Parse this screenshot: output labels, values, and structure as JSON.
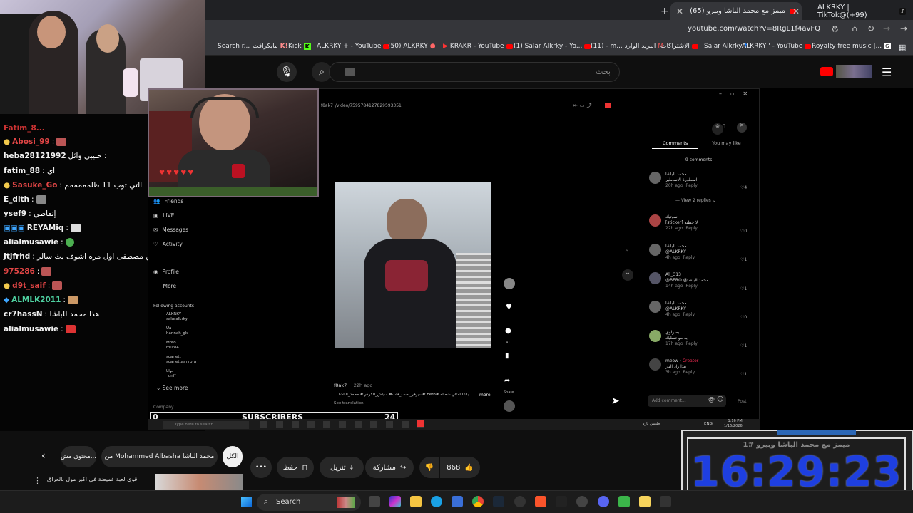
{
  "browser": {
    "tabs": [
      {
        "label": "ميمز مع محمد الباشا وبيرو (65)",
        "close": "✕"
      },
      {
        "label": "ALKRKY | TikTok@(+99)",
        "close": ""
      }
    ],
    "new_tab_label": "+",
    "url": "youtube.com/watch?v=8RgL1f4avFQ",
    "bookmarks": [
      "Search r...",
      "مايكرافت",
      "Kick",
      "ALKRKY + - YouTube",
      "(50) ALKRKY",
      "KRAKR - YouTube",
      "(1) Salar Alkrky - Yo...",
      "(11) - m... البريد الوارد",
      "الاشتراكات",
      "Salar Alkrky",
      "ALKRKY ' - YouTube",
      "Royalty free music |..."
    ]
  },
  "youtube_header": {
    "search_placeholder": "بحث"
  },
  "chat": [
    {
      "user": "Fatim_8...",
      "msg": "",
      "color": "#cc3333"
    },
    {
      "user": "Abosi_99",
      "msg": "",
      "color": "#e04545"
    },
    {
      "user": "heba28121992",
      "msg": "حبيبي وائل :",
      "color": "#ffffff"
    },
    {
      "user": "fatim_88",
      "msg": ": اي",
      "color": "#ffffff"
    },
    {
      "user": "Sasuke_Go",
      "msg": ": التي توب 11 ظلمممممم",
      "color": "#e04545"
    },
    {
      "user": "E_dith",
      "msg": ":",
      "color": "#ffffff"
    },
    {
      "user": "ysef9",
      "msg": ": إنقاطي",
      "color": "#ffffff"
    },
    {
      "user": "REYAMiq",
      "msg": ":",
      "color": "#ffffff"
    },
    {
      "user": "alialmusawie",
      "msg": ":",
      "color": "#ffffff"
    },
    {
      "user": "Jtjfrhd",
      "msg": ": شنو ممنوع تروواني من متابعين مصطفى اول مره اشوف بث سالر",
      "color": "#ffffff"
    },
    {
      "user": "975286",
      "msg": ":",
      "color": "#e04545"
    },
    {
      "user": "d9t_saif",
      "msg": ":",
      "color": "#e04545"
    },
    {
      "user": "ALMLK2011",
      "msg": ":",
      "color": "#4fd1a1"
    },
    {
      "user": "cr7hassN",
      "msg": ": هذا محمد للباشا",
      "color": "#ffffff"
    },
    {
      "user": "alialmusawie",
      "msg": ":",
      "color": "#ffffff"
    }
  ],
  "tiktok": {
    "url_fragment": "f8ak7_/video/7595784127829593351",
    "sidebar": [
      "Friends",
      "LIVE",
      "Messages",
      "Activity",
      "Profile",
      "More"
    ],
    "following_title": "Following accounts",
    "following": [
      {
        "name": "ALKRKY",
        "handle": "salaralkrky"
      },
      {
        "name": "Ua",
        "handle": "hannah_gk"
      },
      {
        "name": "Moto",
        "handle": "m0to4"
      },
      {
        "name": "scarlett",
        "handle": "scarlettaanrora"
      },
      {
        "name": "جوانا",
        "handle": "_dnff"
      }
    ],
    "see_more": "See more",
    "company": "Company",
    "tabs": [
      "Comments",
      "You may like"
    ],
    "comment_count": "9 comments",
    "comments": [
      {
        "name": "محمد الباشا",
        "text": "اسطورة الاساطير",
        "time": "20h ago",
        "likes": "4"
      },
      {
        "name": "سوتيك",
        "text": "[sticker] لا خطيه",
        "time": "22h ago",
        "likes": "0"
      },
      {
        "name": "محمد الباشا",
        "text": "@ALKRKY",
        "time": "4h ago",
        "likes": "1"
      },
      {
        "name": "Ali_313",
        "text": "@BERO @محمد الباشا",
        "time": "14h ago",
        "likes": "1"
      },
      {
        "name": "محمد الباشا",
        "text": "@ALKRKY",
        "time": "4h ago",
        "likes": "0"
      },
      {
        "name": "بصراوي",
        "text": "ابد مو تسليك",
        "time": "17h ago",
        "likes": "1"
      },
      {
        "name": "meow",
        "text": "هذا راد النار",
        "time": "3h ago",
        "likes": "1"
      }
    ],
    "view_replies": "View 2 replies",
    "reply_label": "Reply",
    "creator_label": "Creator",
    "add_comment": "Add comment...",
    "post": "Post",
    "author": "f8ak7_",
    "author_time": "22h ago",
    "caption": "... سيرفر_نصف_قلب# سياش_الكركي# محمد_الباشا# bero# باشا امثلي شحاله",
    "more": "more",
    "see_translation": "See translation",
    "actions": [
      "",
      "",
      "41",
      "",
      "Share"
    ]
  },
  "subscribers": {
    "label": "SUBSCRIBERS",
    "current": "0",
    "goal": "24"
  },
  "video_actions": {
    "likes": "868",
    "share": "مشاركة",
    "download": "تنزيل",
    "save": "حفظ",
    "more": "•••",
    "chips": [
      "الكل",
      "من Mohammed Albasha محمد الباشا",
      "محتوى مش..."
    ],
    "next_video": "اقوى لعبة غميضة في اكبر مول بالعراق"
  },
  "clock": {
    "time": "16:29:23",
    "overlay_text": "ميمز مع محمد الباشا وبيرو #1"
  },
  "taskbar": {
    "search": "Search",
    "inner_search": "Type here to search",
    "inner_time": "1:16 PM",
    "inner_date": "1/16/2026",
    "lang": "ENG",
    "weather": "طقس بارد"
  }
}
